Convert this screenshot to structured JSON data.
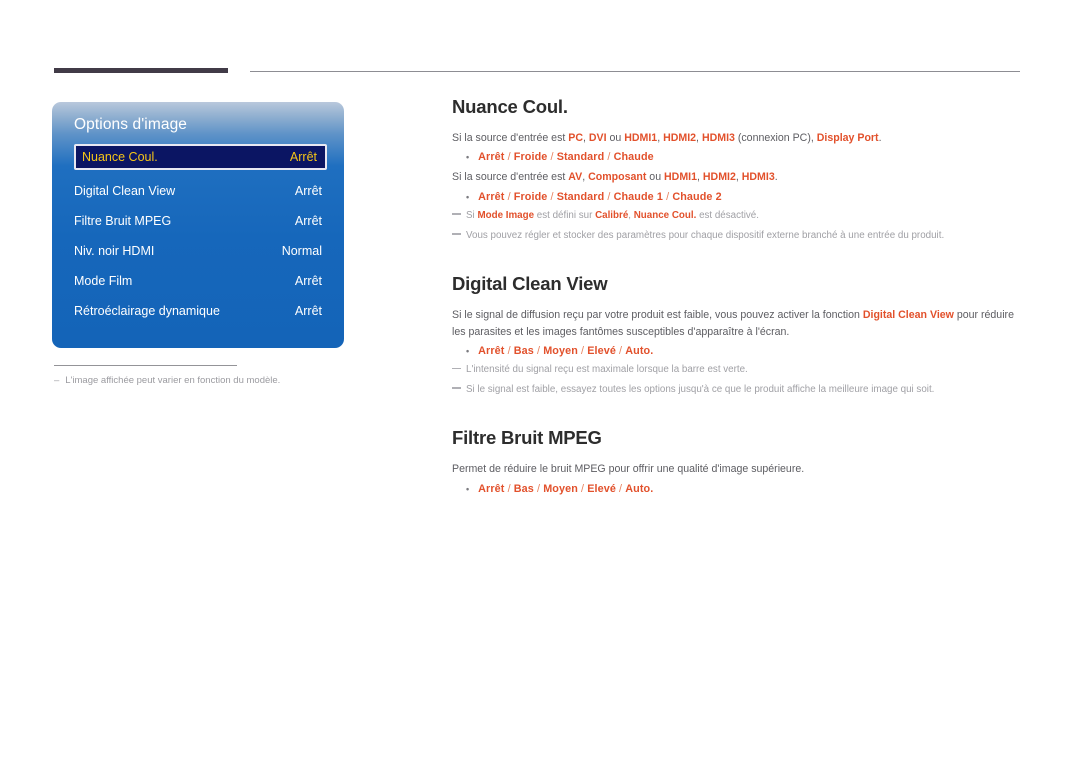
{
  "header": {
    "rule_thick": "",
    "rule_thin": ""
  },
  "osd": {
    "title": "Options d'image",
    "rows": [
      {
        "label": "Nuance Coul.",
        "value": "Arrêt",
        "selected": true
      },
      {
        "label": "Digital Clean View",
        "value": "Arrêt",
        "selected": false
      },
      {
        "label": "Filtre Bruit MPEG",
        "value": "Arrêt",
        "selected": false
      },
      {
        "label": "Niv. noir HDMI",
        "value": "Normal",
        "selected": false
      },
      {
        "label": "Mode Film",
        "value": "Arrêt",
        "selected": false
      },
      {
        "label": "Rétroéclairage dynamique",
        "value": "Arrêt",
        "selected": false
      }
    ],
    "note_dash": "–",
    "note": "L'image affichée peut varier en fonction du modèle."
  },
  "sections": [
    {
      "title": "Nuance Coul.",
      "p1_a": "Si la source d'entrée est ",
      "p1_b1": "PC",
      "p1_c1": ", ",
      "p1_b2": "DVI",
      "p1_c2": " ou ",
      "p1_b3": "HDMI1",
      "p1_c3": ", ",
      "p1_b4": "HDMI2",
      "p1_c4": ", ",
      "p1_b5": "HDMI3",
      "p1_c5": " (connexion PC), ",
      "p1_b6": "Display Port",
      "p1_c6": ".",
      "bullet1": "Arrêt / Froide / Standard / Chaude",
      "p2_a": "Si la source d'entrée est ",
      "p2_b1": "AV",
      "p2_c1": ", ",
      "p2_b2": "Composant",
      "p2_c2": " ou ",
      "p2_b3": "HDMI1",
      "p2_c3": ", ",
      "p2_b4": "HDMI2",
      "p2_c4": ", ",
      "p2_b5": "HDMI3",
      "p2_c5": ".",
      "bullet2": "Arrêt / Froide / Standard / Chaude 1 / Chaude 2",
      "note1_a": "Si ",
      "note1_b1": "Mode Image",
      "note1_c1": " est défini sur ",
      "note1_b2": "Calibré",
      "note1_c2": ", ",
      "note1_b3": "Nuance Coul.",
      "note1_c3": " est désactivé.",
      "note2": "Vous pouvez régler et stocker des paramètres pour chaque dispositif externe branché à une entrée du produit."
    },
    {
      "title": "Digital Clean View",
      "p1_a": "Si le signal de diffusion reçu par votre produit est faible, vous pouvez activer la fonction ",
      "p1_b": "Digital Clean View",
      "p1_c": " pour réduire les parasites et les images fantômes susceptibles d'apparaître à l'écran.",
      "bullet": "Arrêt / Bas / Moyen / Elevé / Auto.",
      "note1": "L'intensité du signal reçu est maximale lorsque la barre est verte.",
      "note2": "Si le signal est faible, essayez toutes les options jusqu'à ce que le produit affiche la meilleure image qui soit."
    },
    {
      "title": "Filtre Bruit MPEG",
      "p1": "Permet de réduire le bruit MPEG pour offrir une qualité d'image supérieure.",
      "bullet": "Arrêt / Bas / Moyen / Elevé / Auto."
    }
  ],
  "colors": {
    "accent": "#e2512c",
    "osd_blue": "#1667bb",
    "osd_selected_bg": "#0b1563",
    "osd_selected_text": "#f5c518",
    "rule_dark": "#413b47",
    "muted": "#a0a0a5"
  }
}
